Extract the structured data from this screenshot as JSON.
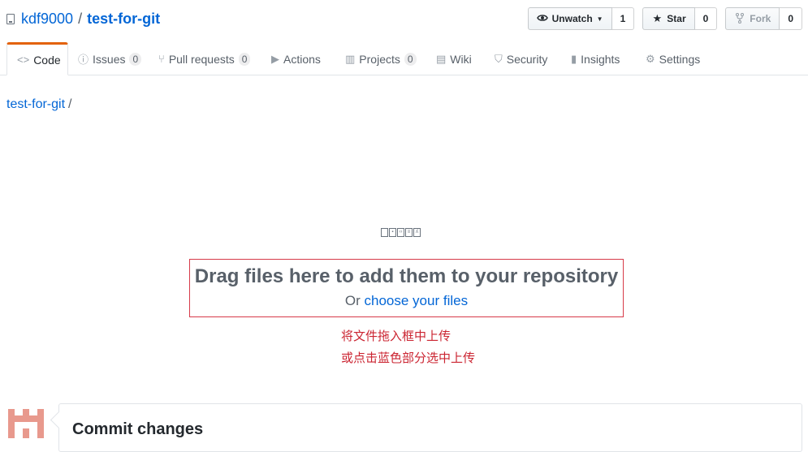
{
  "repo": {
    "owner": "kdf9000",
    "separator": "/",
    "name": "test-for-git"
  },
  "actions": {
    "watch": {
      "label": "Unwatch",
      "count": "1"
    },
    "star": {
      "label": "Star",
      "count": "0"
    },
    "fork": {
      "label": "Fork",
      "count": "0"
    }
  },
  "tabs": [
    {
      "label": "Code",
      "icon": "code-icon"
    },
    {
      "label": "Issues",
      "icon": "issue-icon",
      "count": "0"
    },
    {
      "label": "Pull requests",
      "icon": "pull-request-icon",
      "count": "0"
    },
    {
      "label": "Actions",
      "icon": "play-icon"
    },
    {
      "label": "Projects",
      "icon": "project-icon",
      "count": "0"
    },
    {
      "label": "Wiki",
      "icon": "book-icon"
    },
    {
      "label": "Security",
      "icon": "shield-icon"
    },
    {
      "label": "Insights",
      "icon": "graph-icon"
    },
    {
      "label": "Settings",
      "icon": "gear-icon"
    }
  ],
  "breadcrumb": {
    "repo": "test-for-git",
    "separator": "/"
  },
  "upload": {
    "title": "Drag files here to add them to your repository",
    "or_text": "Or",
    "choose_link": "choose your files"
  },
  "notes": {
    "line1": "将文件拖入框中上传",
    "line2": "或点击蓝色部分选中上传"
  },
  "commit": {
    "title": "Commit changes"
  },
  "colors": {
    "link": "#0366d6",
    "accent_tab": "#e36209",
    "annotation": "#cb2431"
  }
}
